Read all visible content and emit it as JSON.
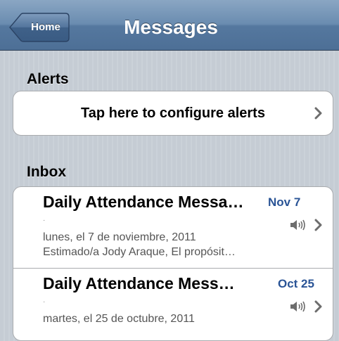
{
  "navbar": {
    "back_label": "Home",
    "title": "Messages"
  },
  "alerts": {
    "header": "Alerts",
    "configure_label": "Tap here to configure alerts"
  },
  "inbox": {
    "header": "Inbox",
    "messages": [
      {
        "title": "Daily Attendance Messa…",
        "date": "Nov 7",
        "line1": "lunes, el 7 de noviembre, 2011",
        "line2": "Estimado/a Jody Araque,  El propósit…"
      },
      {
        "title": "Daily Attendance Mess…",
        "date": "Oct 25",
        "line1": "martes, el 25 de octubre, 2011",
        "line2": ""
      }
    ]
  },
  "colors": {
    "navbar": "#6a8cb0",
    "date_accent": "#2a5496",
    "background": "#c5ccd4"
  },
  "icons": [
    "back-arrow-button",
    "chevron-right-icon",
    "speaker-icon"
  ]
}
